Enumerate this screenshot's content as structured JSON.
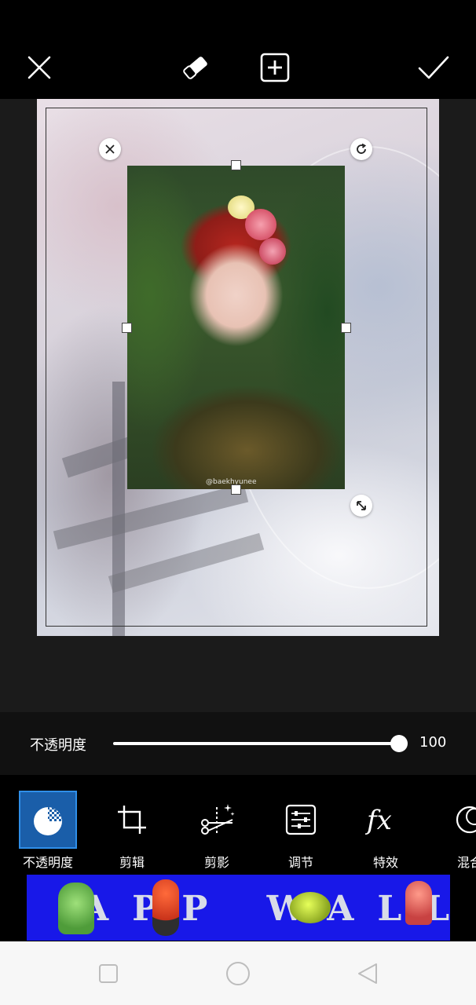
{
  "toolbar_top": {
    "close_icon": "close-icon",
    "eraser_icon": "eraser-icon",
    "add_icon": "add-square-icon",
    "confirm_icon": "checkmark-icon"
  },
  "photo": {
    "watermark": "@baekhyunee"
  },
  "opacity": {
    "label": "不透明度",
    "value": "100",
    "level_percent": 100
  },
  "tools": [
    {
      "label": "不透明度",
      "icon": "opacity-icon",
      "active": true
    },
    {
      "label": "剪辑",
      "icon": "crop-icon",
      "active": false
    },
    {
      "label": "剪影",
      "icon": "cutout-scissors-icon",
      "active": false
    },
    {
      "label": "调节",
      "icon": "adjust-sliders-icon",
      "active": false
    },
    {
      "label": "特效",
      "icon": "fx-icon",
      "active": false
    },
    {
      "label": "混合",
      "icon": "blend-icon",
      "active": false
    }
  ],
  "ad": {
    "text": "APP WALL"
  },
  "system_nav": {
    "recent": "square-icon",
    "home": "circle-icon",
    "back": "triangle-back-icon"
  },
  "colors": {
    "active_tool": "#1a5ea9",
    "ad_background": "#1818e8"
  }
}
